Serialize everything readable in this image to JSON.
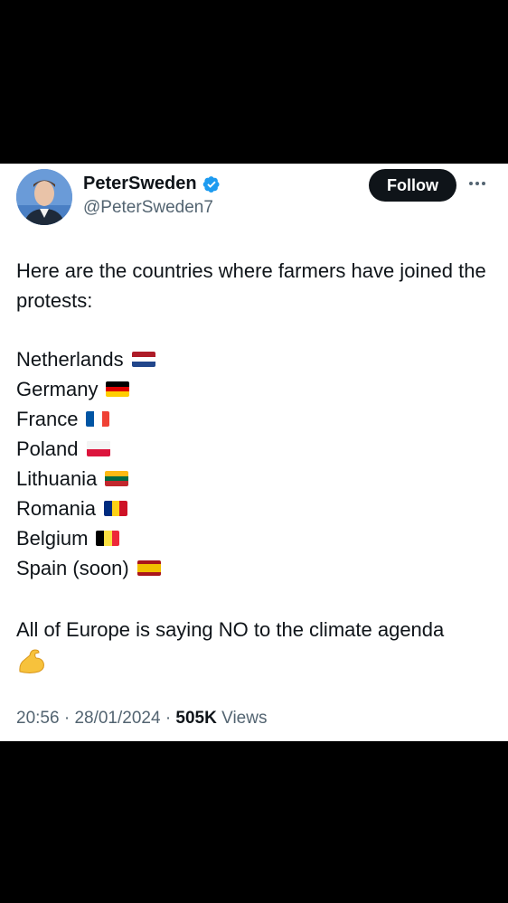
{
  "author": {
    "display_name": "PeterSweden",
    "handle": "@PeterSweden7",
    "verified": true,
    "verified_color": "#1d9bf0"
  },
  "follow_label": "Follow",
  "more_icon": "more-horizontal-icon",
  "tweet": {
    "intro": "Here are the countries where farmers have joined the protests:",
    "countries": [
      {
        "name": "Netherlands",
        "flag": "netherlands-flag-icon"
      },
      {
        "name": "Germany",
        "flag": "germany-flag-icon"
      },
      {
        "name": "France",
        "flag": "france-flag-icon"
      },
      {
        "name": "Poland",
        "flag": "poland-flag-icon"
      },
      {
        "name": "Lithuania",
        "flag": "lithuania-flag-icon"
      },
      {
        "name": "Romania",
        "flag": "romania-flag-icon"
      },
      {
        "name": "Belgium",
        "flag": "belgium-flag-icon"
      },
      {
        "name": "Spain (soon)",
        "flag": "spain-flag-icon"
      }
    ],
    "closing": "All of Europe is saying NO to the climate agenda",
    "closing_emoji": "flexed-biceps-emoji"
  },
  "meta": {
    "time": "20:56",
    "date": "28/01/2024",
    "views_count": "505K",
    "views_label": "Views"
  }
}
